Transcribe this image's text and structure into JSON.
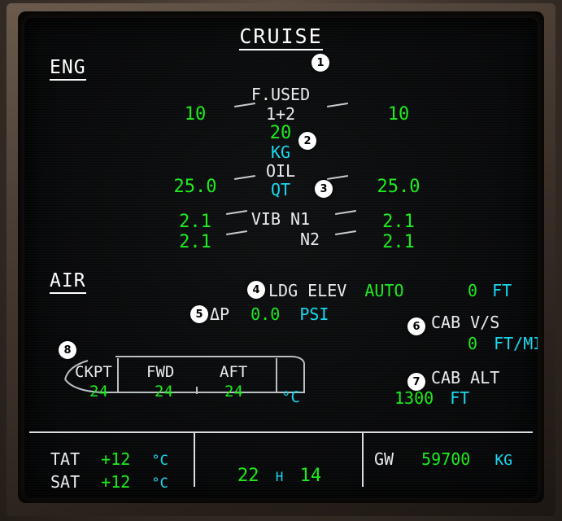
{
  "display": {
    "title": "CRUISE",
    "sections": {
      "eng": "ENG",
      "air": "AIR"
    }
  },
  "eng": {
    "fuel_used": {
      "label": "F.USED",
      "sub_label": "1+2",
      "total": "20",
      "unit": "KG",
      "left": "10",
      "right": "10"
    },
    "oil": {
      "label": "OIL",
      "unit": "QT",
      "left": "25.0",
      "right": "25.0"
    },
    "vib": {
      "label": "VIB N1",
      "label2": "N2",
      "n1_left": "2.1",
      "n1_right": "2.1",
      "n2_left": "2.1",
      "n2_right": "2.1"
    }
  },
  "air": {
    "ldg_elev": {
      "label": "LDG ELEV",
      "mode": "AUTO",
      "value": "0",
      "unit": "FT"
    },
    "delta_p": {
      "label": "ΔP",
      "value": "0.0",
      "unit": "PSI"
    },
    "cab_vs": {
      "label": "CAB V/S",
      "value": "0",
      "unit": "FT/MIN"
    },
    "cab_alt": {
      "label": "CAB ALT",
      "value": "1300",
      "unit": "FT"
    },
    "cabin_temp": {
      "unit": "°C",
      "zones": [
        {
          "name": "CKPT",
          "value": "24"
        },
        {
          "name": "FWD",
          "value": "24"
        },
        {
          "name": "AFT",
          "value": "24"
        }
      ]
    }
  },
  "status_bar": {
    "tat": {
      "label": "TAT",
      "value": "+12",
      "unit": "°C"
    },
    "sat": {
      "label": "SAT",
      "value": "+12",
      "unit": "°C"
    },
    "clock": {
      "hours": "22",
      "separator": "H",
      "minutes": "14"
    },
    "gw": {
      "label": "GW",
      "value": "59700",
      "unit": "KG"
    }
  },
  "callouts": [
    {
      "n": "1"
    },
    {
      "n": "2"
    },
    {
      "n": "3"
    },
    {
      "n": "4"
    },
    {
      "n": "5"
    },
    {
      "n": "6"
    },
    {
      "n": "7"
    },
    {
      "n": "8"
    }
  ],
  "colors": {
    "value_green": "#1aec1a",
    "unit_cyan": "#16d8f0",
    "label_white": "#e9ecef",
    "screen_black": "#08090a"
  }
}
